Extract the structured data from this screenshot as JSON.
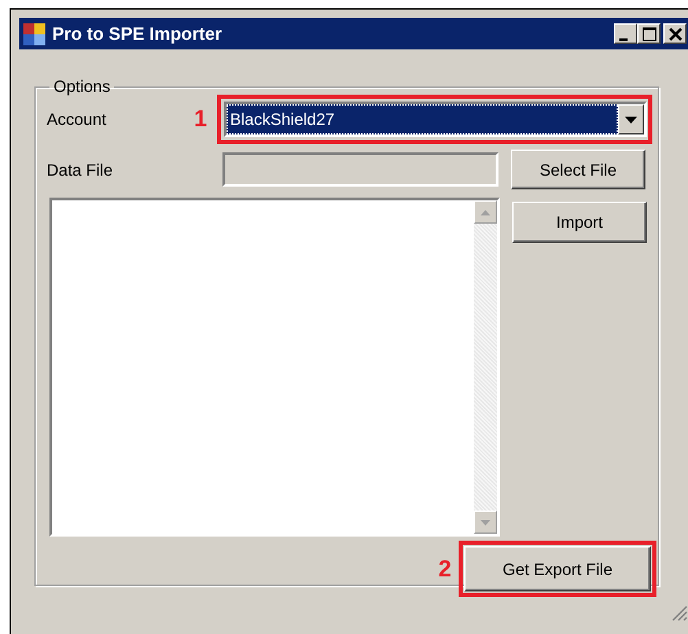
{
  "window": {
    "title": "Pro to SPE Importer",
    "controls": [
      {
        "kind": "minimize"
      },
      {
        "kind": "maximize"
      },
      {
        "kind": "close"
      }
    ]
  },
  "options_group": {
    "title": "Options",
    "account": {
      "label": "Account",
      "value": "BlackShield27",
      "highlighted": true
    },
    "data_file": {
      "label": "Data File",
      "disabled": true
    },
    "select_file_button": "Select File",
    "import_button": "Import",
    "get_export_file_button": "Get Export File"
  },
  "annotations": [
    {
      "number": "1"
    },
    {
      "number": "2"
    }
  ]
}
